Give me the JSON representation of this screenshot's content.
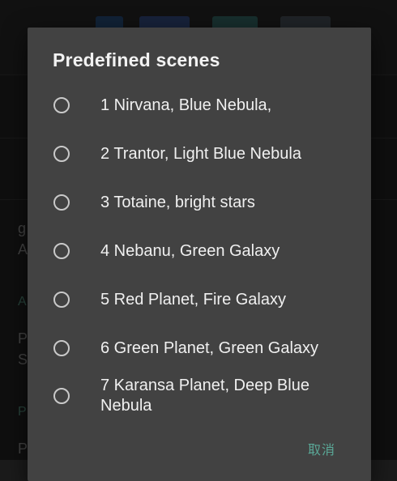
{
  "dialog": {
    "title": "Predefined scenes",
    "options": [
      {
        "label": "1 Nirvana, Blue Nebula,",
        "selected": false
      },
      {
        "label": "2 Trantor, Light Blue Nebula",
        "selected": false
      },
      {
        "label": "3 Totaine, bright stars",
        "selected": false
      },
      {
        "label": "4 Nebanu, Green Galaxy",
        "selected": false
      },
      {
        "label": "5 Red Planet, Fire Galaxy",
        "selected": false
      },
      {
        "label": "6 Green Planet, Green Galaxy",
        "selected": false
      },
      {
        "label": "7 Karansa Planet, Deep Blue Nebula",
        "selected": false
      }
    ],
    "cancel_label": "取消"
  },
  "background": {
    "fragments": [
      "g",
      "A",
      "A",
      "P",
      "S",
      "P",
      "P"
    ]
  },
  "colors": {
    "dialog_bg": "#424242",
    "accent": "#5aa897",
    "text": "#f0f0f0",
    "radio": "#c9c9c9"
  }
}
